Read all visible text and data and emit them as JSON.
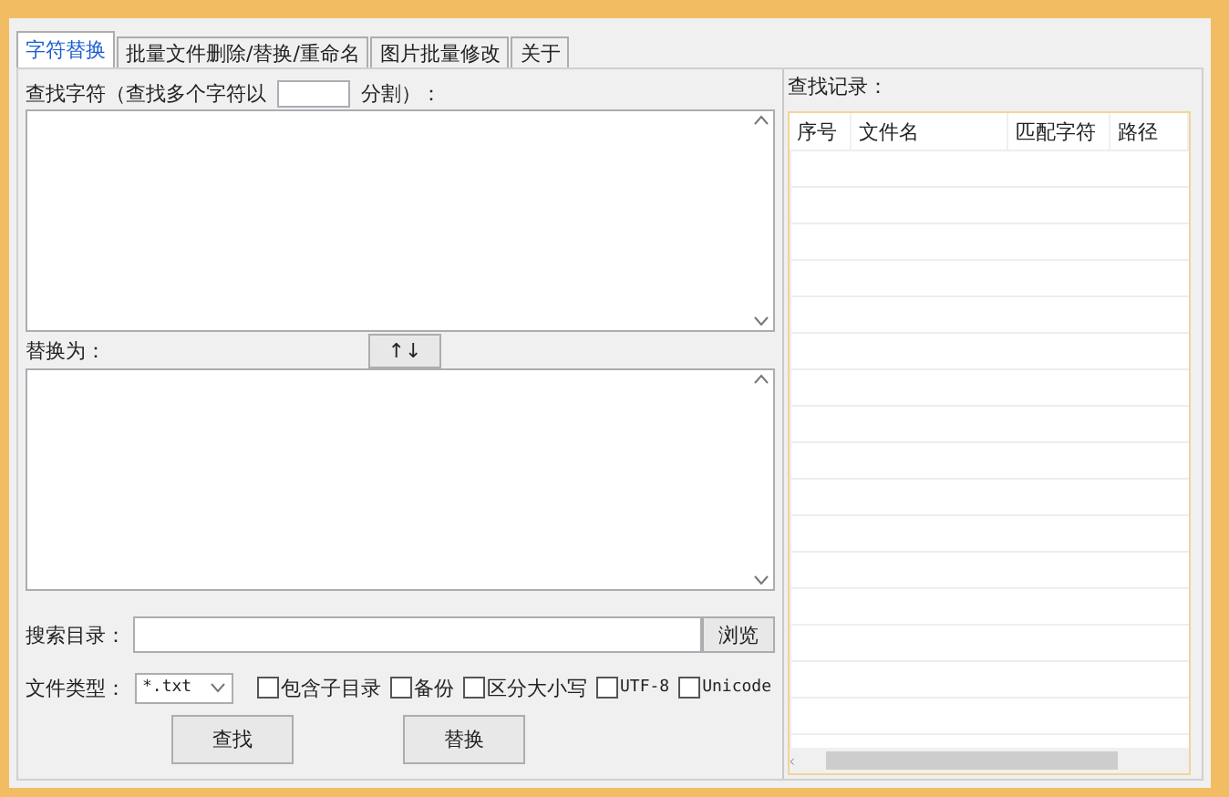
{
  "tabs": [
    {
      "label": "字符替换",
      "selected": true
    },
    {
      "label": "批量文件删除/替换/重命名",
      "selected": false
    },
    {
      "label": "图片批量修改",
      "selected": false
    },
    {
      "label": "关于",
      "selected": false
    }
  ],
  "find": {
    "label_before": "查找字符（查找多个字符以",
    "label_after": "分割）："
  },
  "replace": {
    "label": "替换为：",
    "swap_button": "↑↓"
  },
  "search_dir": {
    "label": "搜索目录：",
    "browse_button": "浏览"
  },
  "file_type": {
    "label": "文件类型：",
    "value": "*.txt"
  },
  "options": [
    {
      "label": "包含子目录",
      "checked": false,
      "mono": false
    },
    {
      "label": "备份",
      "checked": false,
      "mono": false
    },
    {
      "label": "区分大小写",
      "checked": false,
      "mono": false
    },
    {
      "label": "UTF-8",
      "checked": false,
      "mono": true
    },
    {
      "label": "Unicode",
      "checked": false,
      "mono": true
    }
  ],
  "buttons": [
    "查找",
    "替换"
  ],
  "results": {
    "label": "查找记录：",
    "columns": [
      "序号",
      "文件名",
      "匹配字符",
      "路径"
    ]
  }
}
